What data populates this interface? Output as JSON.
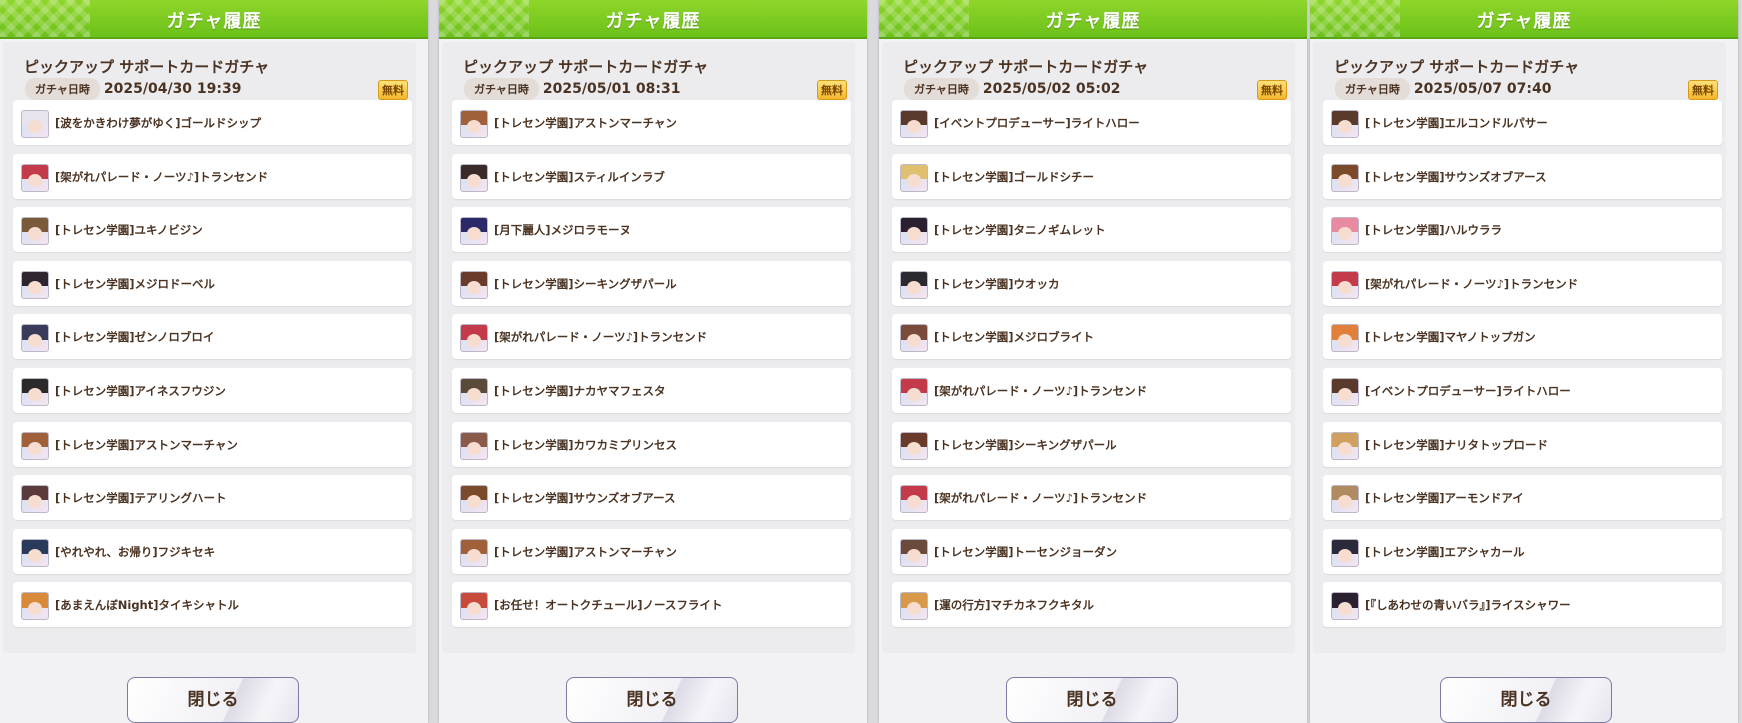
{
  "panels": [
    {
      "header_title": "ガチャ履歴",
      "gacha_name": "ピックアップ サポートカードガチャ",
      "date_label": "ガチャ日時",
      "date": "2025/04/30 19:39",
      "free_badge": "無料",
      "close_label": "閉じる",
      "items": [
        {
          "title": "[波をかきわけ夢がゆく]ゴールドシップ",
          "hair": "#e8e4ee"
        },
        {
          "title": "[架がれパレード・ノーツ♪]トランセンド",
          "hair": "#c33a4a"
        },
        {
          "title": "[トレセン学園]ユキノビジン",
          "hair": "#7a5a3a"
        },
        {
          "title": "[トレセン学園]メジロドーベル",
          "hair": "#2e2430"
        },
        {
          "title": "[トレセン学園]ゼンノロブロイ",
          "hair": "#3a3a5a"
        },
        {
          "title": "[トレセン学園]アイネスフウジン",
          "hair": "#2a2a2a"
        },
        {
          "title": "[トレセン学園]アストンマーチャン",
          "hair": "#a0603a"
        },
        {
          "title": "[トレセン学園]テアリングハート",
          "hair": "#5a3a3a"
        },
        {
          "title": "[やれやれ、お帰り]フジキセキ",
          "hair": "#2a3a5a"
        },
        {
          "title": "[あまえんぼNight]タイキシャトル",
          "hair": "#d88a3a"
        }
      ]
    },
    {
      "header_title": "ガチャ履歴",
      "gacha_name": "ピックアップ サポートカードガチャ",
      "date_label": "ガチャ日時",
      "date": "2025/05/01 08:31",
      "free_badge": "無料",
      "close_label": "閉じる",
      "items": [
        {
          "title": "[トレセン学園]アストンマーチャン",
          "hair": "#a0603a"
        },
        {
          "title": "[トレセン学園]スティルインラブ",
          "hair": "#3a2a2a"
        },
        {
          "title": "[月下麗人]メジロラモーヌ",
          "hair": "#2a2a6a"
        },
        {
          "title": "[トレセン学園]シーキングザパール",
          "hair": "#6a3a2a"
        },
        {
          "title": "[架がれパレード・ノーツ♪]トランセンド",
          "hair": "#c33a4a"
        },
        {
          "title": "[トレセン学園]ナカヤマフェスタ",
          "hair": "#5a4a3a"
        },
        {
          "title": "[トレセン学園]カワカミプリンセス",
          "hair": "#8a5a4a"
        },
        {
          "title": "[トレセン学園]サウンズオブアース",
          "hair": "#7a4a2a"
        },
        {
          "title": "[トレセン学園]アストンマーチャン",
          "hair": "#a0603a"
        },
        {
          "title": "[お任せ！オートクチュール]ノースフライト",
          "hair": "#c84a3a"
        }
      ]
    },
    {
      "header_title": "ガチャ履歴",
      "gacha_name": "ピックアップ サポートカードガチャ",
      "date_label": "ガチャ日時",
      "date": "2025/05/02 05:02",
      "free_badge": "無料",
      "close_label": "閉じる",
      "items": [
        {
          "title": "[イベントプロデューサー]ライトハロー",
          "hair": "#5a3a2a"
        },
        {
          "title": "[トレセン学園]ゴールドシチー",
          "hair": "#e0c070"
        },
        {
          "title": "[トレセン学園]タニノギムレット",
          "hair": "#2a2030"
        },
        {
          "title": "[トレセン学園]ウオッカ",
          "hair": "#2a2a30"
        },
        {
          "title": "[トレセン学園]メジロブライト",
          "hair": "#7a4a3a"
        },
        {
          "title": "[架がれパレード・ノーツ♪]トランセンド",
          "hair": "#c33a4a"
        },
        {
          "title": "[トレセン学園]シーキングザパール",
          "hair": "#6a3a2a"
        },
        {
          "title": "[架がれパレード・ノーツ♪]トランセンド",
          "hair": "#c33a4a"
        },
        {
          "title": "[トレセン学園]トーセンジョーダン",
          "hair": "#6a4a3a"
        },
        {
          "title": "[運の行方]マチカネフクキタル",
          "hair": "#d89a4a"
        }
      ]
    },
    {
      "header_title": "ガチャ履歴",
      "gacha_name": "ピックアップ サポートカードガチャ",
      "date_label": "ガチャ日時",
      "date": "2025/05/07 07:40",
      "free_badge": "無料",
      "close_label": "閉じる",
      "items": [
        {
          "title": "[トレセン学園]エルコンドルパサー",
          "hair": "#5a3a2a"
        },
        {
          "title": "[トレセン学園]サウンズオブアース",
          "hair": "#7a4a2a"
        },
        {
          "title": "[トレセン学園]ハルウララ",
          "hair": "#e88aa0"
        },
        {
          "title": "[架がれパレード・ノーツ♪]トランセンド",
          "hair": "#c33a4a"
        },
        {
          "title": "[トレセン学園]マヤノトップガン",
          "hair": "#e0803a"
        },
        {
          "title": "[イベントプロデューサー]ライトハロー",
          "hair": "#5a3a2a"
        },
        {
          "title": "[トレセン学園]ナリタトップロード",
          "hair": "#d0a060"
        },
        {
          "title": "[トレセン学園]アーモンドアイ",
          "hair": "#b08a60"
        },
        {
          "title": "[トレセン学園]エアシャカール",
          "hair": "#2a2a3a"
        },
        {
          "title": "[『しあわせの青いバラ』]ライスシャワー",
          "hair": "#2a2030"
        }
      ]
    }
  ]
}
